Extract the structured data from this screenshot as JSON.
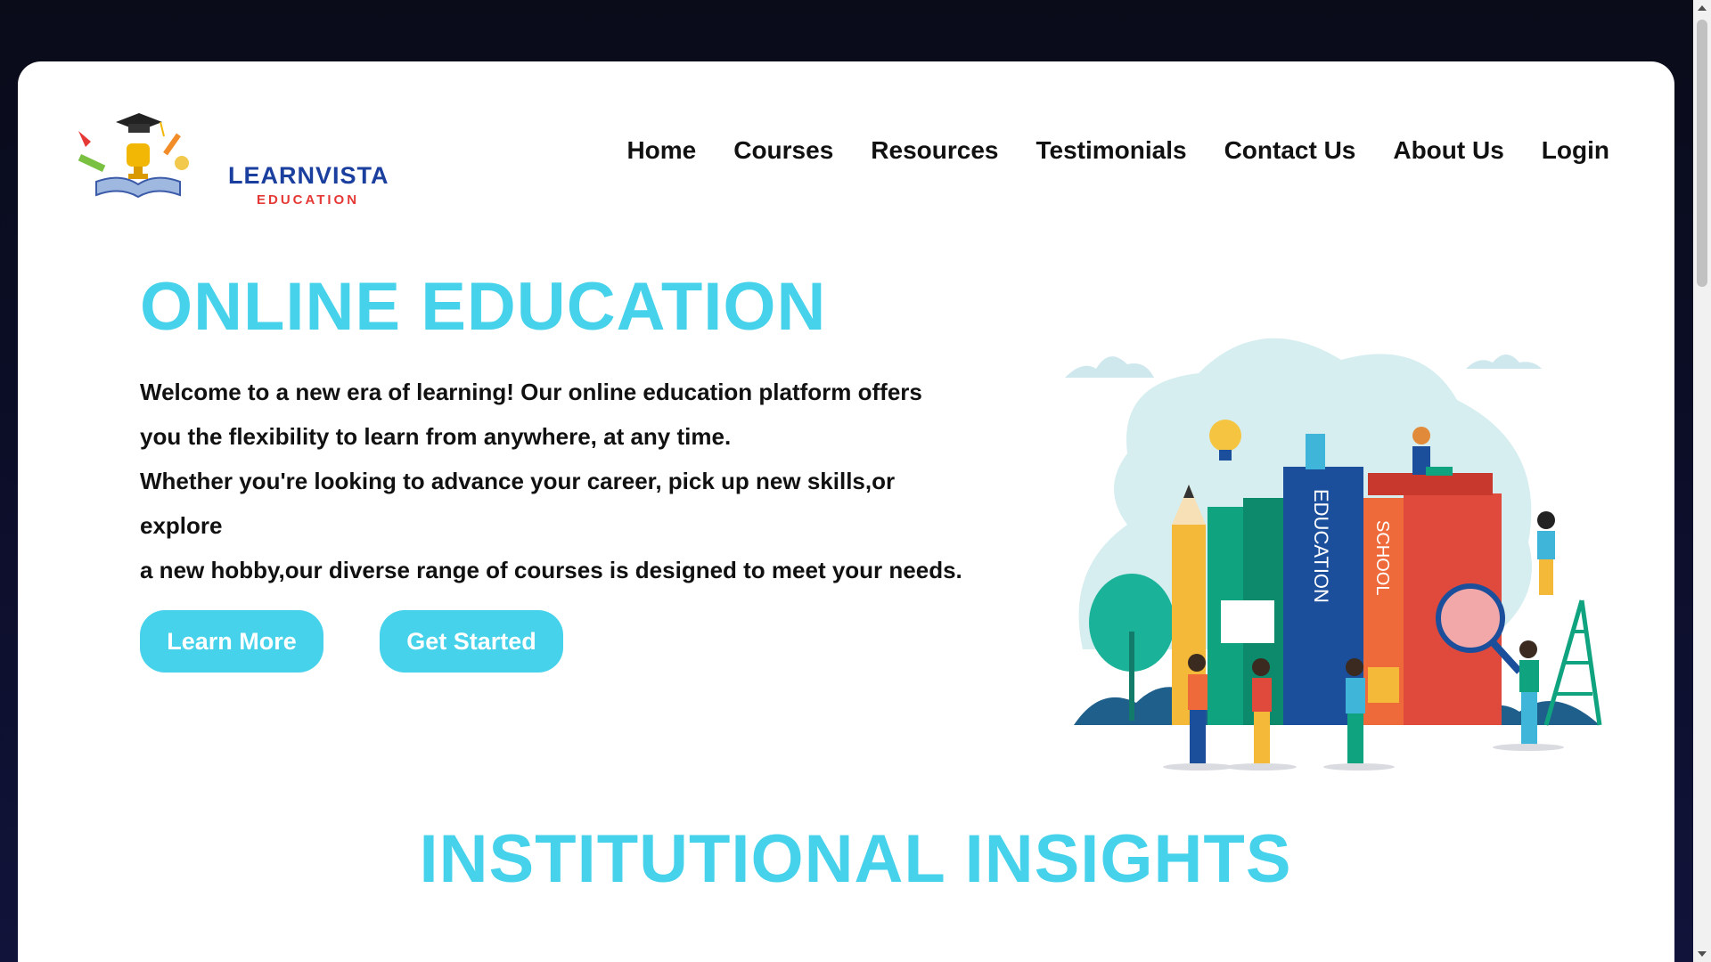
{
  "brand": {
    "name": "LEARNVISTA",
    "subtitle": "EDUCATION"
  },
  "nav": {
    "items": [
      "Home",
      "Courses",
      "Resources",
      "Testimonials",
      "Contact Us",
      "About Us",
      "Login"
    ]
  },
  "hero": {
    "title": "ONLINE EDUCATION",
    "lines": [
      "Welcome to a new era of learning! Our online education platform offers",
      "you the flexibility to learn from anywhere, at any time.",
      "Whether you're looking to advance your career, pick up new skills,or",
      "explore",
      "a new hobby,our diverse range of courses is designed to meet your needs."
    ],
    "learn_more": "Learn More",
    "get_started": "Get Started"
  },
  "illustration": {
    "book_labels": [
      "EDUCATION",
      "SCHOOL"
    ]
  },
  "section": {
    "title": "INSTITUTIONAL INSIGHTS"
  },
  "colors": {
    "accent": "#45d2ea",
    "brand_blue": "#1b3f9e",
    "brand_red": "#e53935"
  }
}
